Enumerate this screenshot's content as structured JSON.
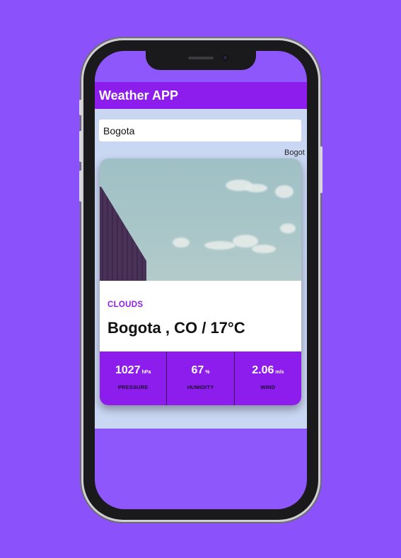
{
  "app": {
    "title": "Weather APP"
  },
  "search": {
    "value": "Bogota",
    "suggestion": "Bogot"
  },
  "weather": {
    "condition": "CLOUDS",
    "location": "Bogota , CO / 17°C",
    "stats": [
      {
        "value": "1027",
        "unit": "hPa",
        "label": "PRESSURE"
      },
      {
        "value": "67",
        "unit": "%",
        "label": "HUMIDITY"
      },
      {
        "value": "2.06",
        "unit": "m/s",
        "label": "WIND"
      }
    ]
  },
  "colors": {
    "background": "#8b52fc",
    "accent": "#8d1ded",
    "app_bg": "#cad7f3"
  }
}
